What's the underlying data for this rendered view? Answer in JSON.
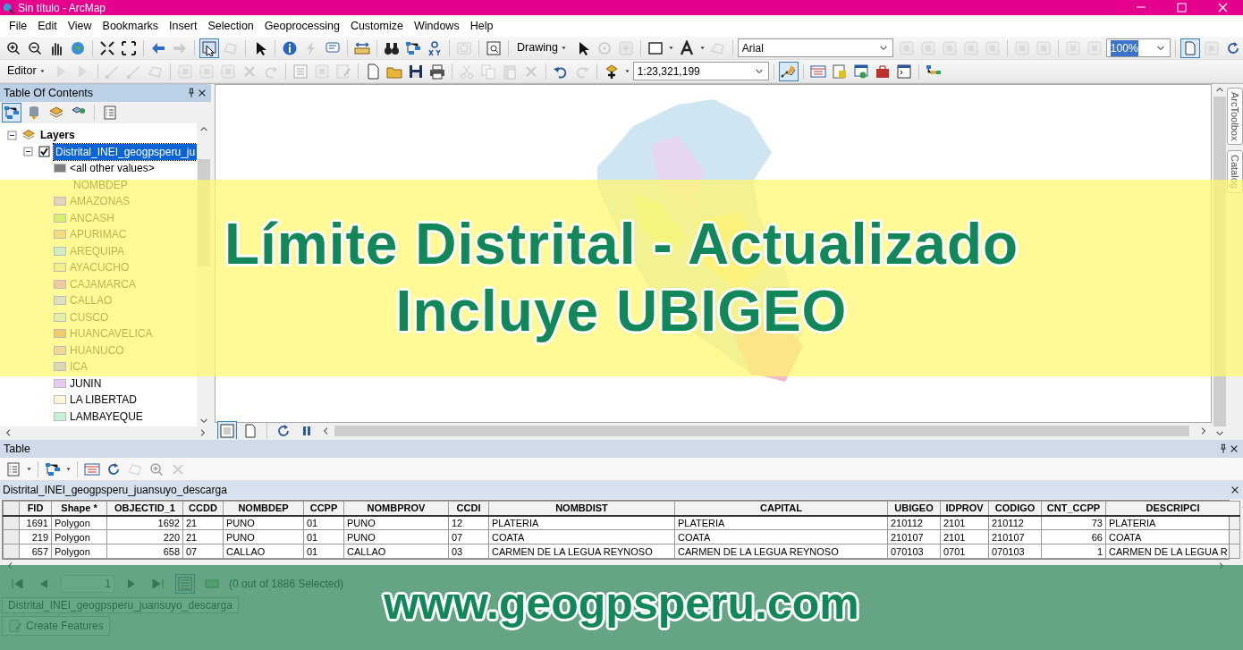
{
  "window": {
    "title": "Sin título - ArcMap"
  },
  "menu": [
    "File",
    "Edit",
    "View",
    "Bookmarks",
    "Insert",
    "Selection",
    "Geoprocessing",
    "Customize",
    "Windows",
    "Help"
  ],
  "toolbar_1": {
    "drawing_menu": "Drawing",
    "font_field": {
      "value": "Arial"
    },
    "zoom_field": {
      "value": "100%"
    }
  },
  "toolbar_2": {
    "editor_menu": "Editor",
    "scale_field": {
      "value": "1:23,321,199"
    }
  },
  "table_of_contents": {
    "title": "Table Of Contents",
    "layers_group": {
      "label": "Layers",
      "expanded": true
    },
    "layer": {
      "label": "Distrital_INEI_geogpsperu_ju",
      "checked": true,
      "selected": true,
      "expanded": true
    },
    "legend_other": {
      "label": "<all other values>",
      "color": "#7f7f7f"
    },
    "legend_field": "NOMBDEP",
    "legend_items": [
      {
        "label": "AMAZONAS",
        "color": "#e6d3b8"
      },
      {
        "label": "ANCASH",
        "color": "#d6f06e"
      },
      {
        "label": "APURIMAC",
        "color": "#f6dc78"
      },
      {
        "label": "AREQUIPA",
        "color": "#d2eec3"
      },
      {
        "label": "AYACUCHO",
        "color": "#f3ee86"
      },
      {
        "label": "CAJAMARCA",
        "color": "#f2c99a"
      },
      {
        "label": "CALLAO",
        "color": "#e0e0bd"
      },
      {
        "label": "CUSCO",
        "color": "#e2f0a4"
      },
      {
        "label": "HUANCAVELICA",
        "color": "#f4cb68"
      },
      {
        "label": "HUANUCO",
        "color": "#f3d797"
      },
      {
        "label": "ICA",
        "color": "#d9d9b6"
      },
      {
        "label": "JUNIN",
        "color": "#e8caf2"
      },
      {
        "label": "LA LIBERTAD",
        "color": "#fdf5d8"
      },
      {
        "label": "LAMBAYEQUE",
        "color": "#c4f1d4"
      }
    ]
  },
  "side_tabs": [
    "ArcToolbox",
    "Catalog"
  ],
  "table_panel": {
    "title": "Table",
    "layer_title": "Distrital_INEI_geogpsperu_juansuyo_descarga",
    "columns": [
      {
        "label": "FID",
        "kind": "number"
      },
      {
        "label": "Shape *",
        "kind": "text"
      },
      {
        "label": "OBJECTID_1",
        "kind": "number"
      },
      {
        "label": "CCDD",
        "kind": "text"
      },
      {
        "label": "NOMBDEP",
        "kind": "text"
      },
      {
        "label": "CCPP",
        "kind": "text"
      },
      {
        "label": "NOMBPROV",
        "kind": "text"
      },
      {
        "label": "CCDI",
        "kind": "text"
      },
      {
        "label": "NOMBDIST",
        "kind": "text"
      },
      {
        "label": "CAPITAL",
        "kind": "text"
      },
      {
        "label": "UBIGEO",
        "kind": "text"
      },
      {
        "label": "IDPROV",
        "kind": "text"
      },
      {
        "label": "CODIGO",
        "kind": "text"
      },
      {
        "label": "CNT_CCPP",
        "kind": "number"
      },
      {
        "label": "DESCRIPCI",
        "kind": "text"
      }
    ],
    "rows": [
      [
        "1691",
        "Polygon",
        "1692",
        "21",
        "PUNO",
        "01",
        "PUNO",
        "12",
        "PLATERIA",
        "PLATERIA",
        "210112",
        "2101",
        "210112",
        "73",
        "PLATERIA"
      ],
      [
        "219",
        "Polygon",
        "220",
        "21",
        "PUNO",
        "01",
        "PUNO",
        "07",
        "COATA",
        "COATA",
        "210107",
        "2101",
        "210107",
        "66",
        "COATA"
      ],
      [
        "657",
        "Polygon",
        "658",
        "07",
        "CALLAO",
        "01",
        "CALLAO",
        "03",
        "CARMEN DE LA LEGUA REYNOSO",
        "CARMEN DE LA LEGUA REYNOSO",
        "070103",
        "0701",
        "070103",
        "1",
        "CARMEN DE LA LEGUA R"
      ]
    ],
    "record": "1",
    "selection_status": "(0 out of 1886 Selected)",
    "bottom_tab": "Distrital_INEI_geogpsperu_juansuyo_descarga",
    "create_features": "Create Features"
  },
  "banner": {
    "lines": [
      "Límite Distrital - Actualizado",
      "Incluye UBIGEO"
    ]
  },
  "footer_banner": {
    "url": "www.geogpsperu.com"
  }
}
